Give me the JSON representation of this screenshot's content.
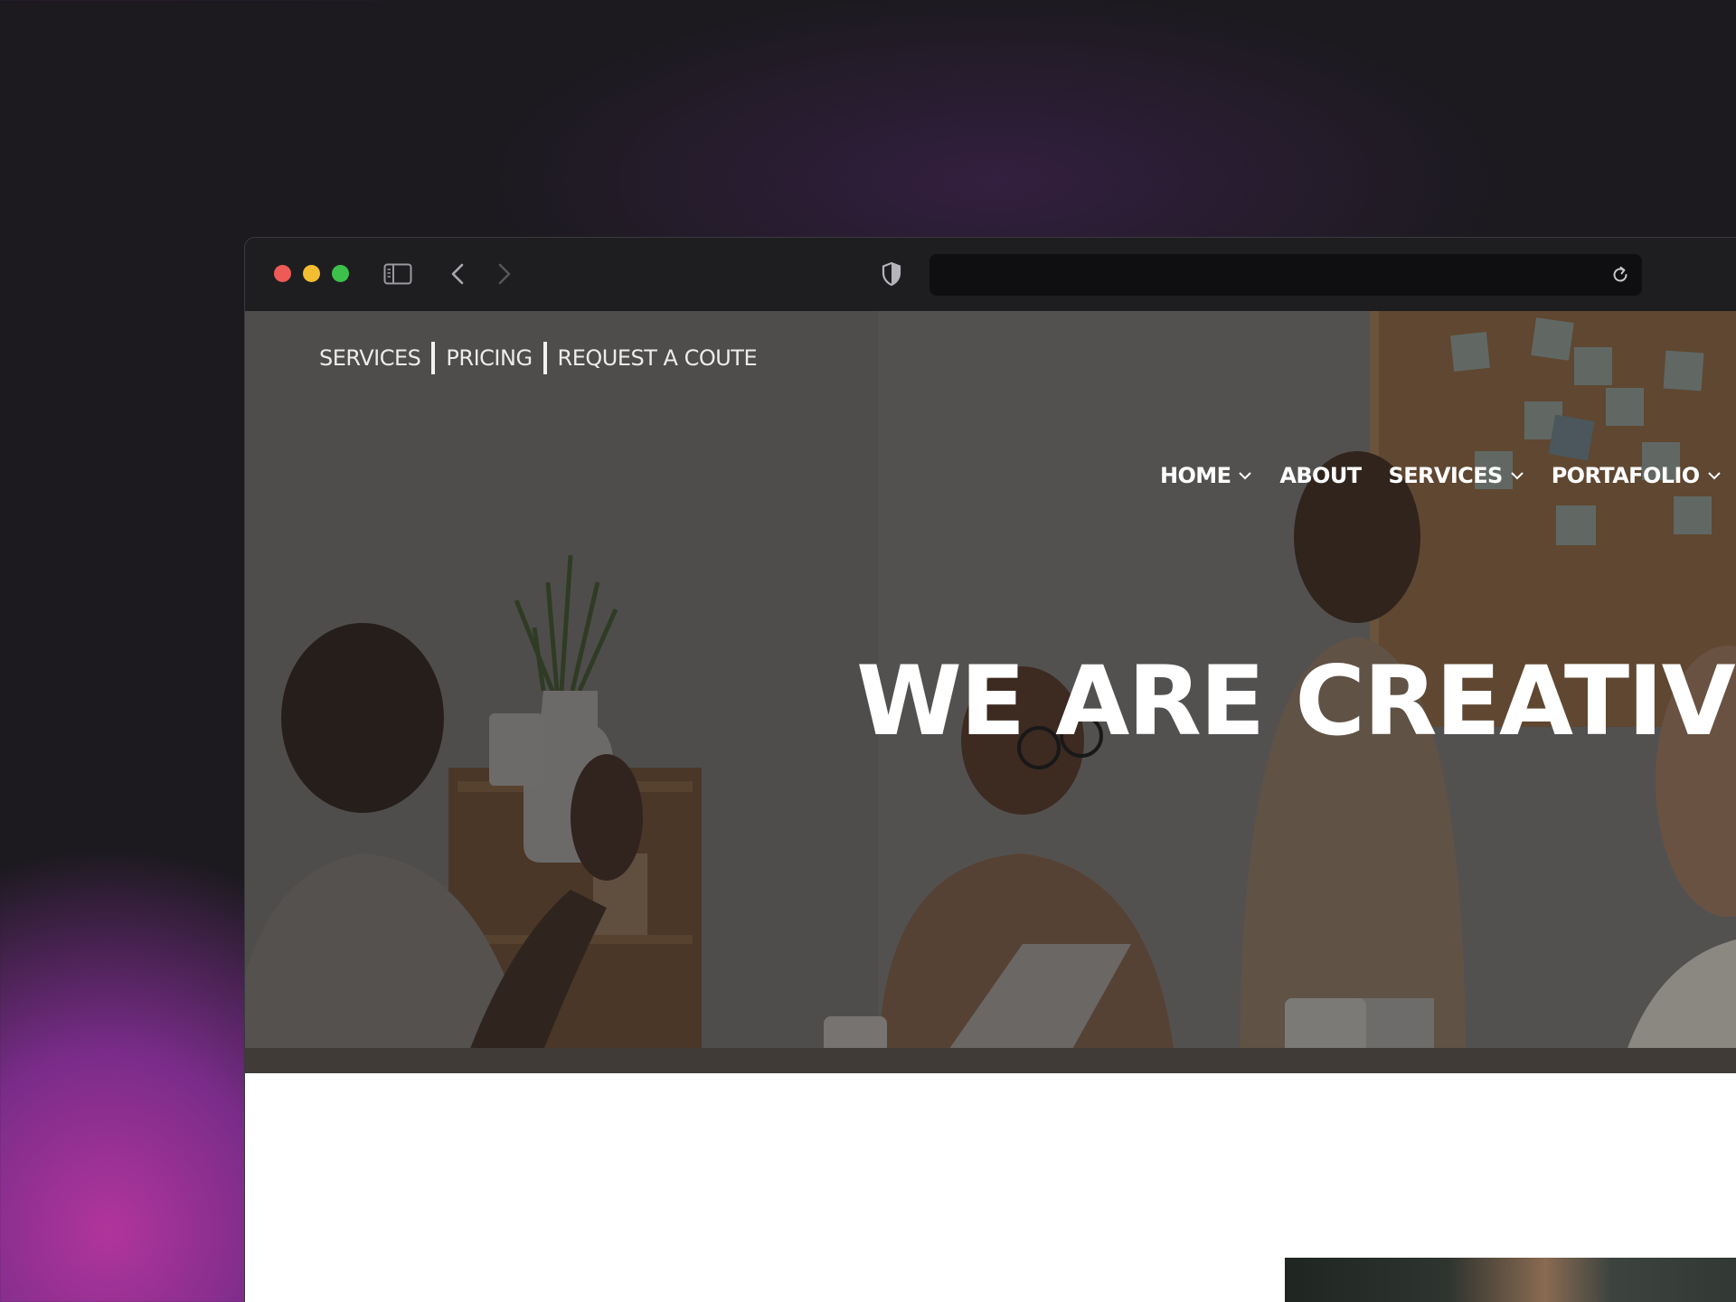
{
  "browser": {
    "url": "",
    "buttons": {
      "sidebar": "sidebar-toggle",
      "back": "back",
      "forward": "forward",
      "reload": "reload"
    }
  },
  "site": {
    "topbar": {
      "links": [
        "SERVICES",
        "PRICING",
        "REQUEST A COUTE"
      ]
    },
    "nav": {
      "items": [
        {
          "label": "HOME",
          "dropdown": true
        },
        {
          "label": "ABOUT",
          "dropdown": false
        },
        {
          "label": "SERVICES",
          "dropdown": true
        },
        {
          "label": "PORTAFOLIO",
          "dropdown": true
        }
      ]
    },
    "hero": {
      "headline": "WE ARE CREATIVE"
    }
  },
  "colors": {
    "traffic_red": "#ee5a55",
    "traffic_yellow": "#f4bd31",
    "traffic_green": "#3cc14a",
    "background": "#1c1a1f",
    "accent_glow": "#b1359b"
  }
}
